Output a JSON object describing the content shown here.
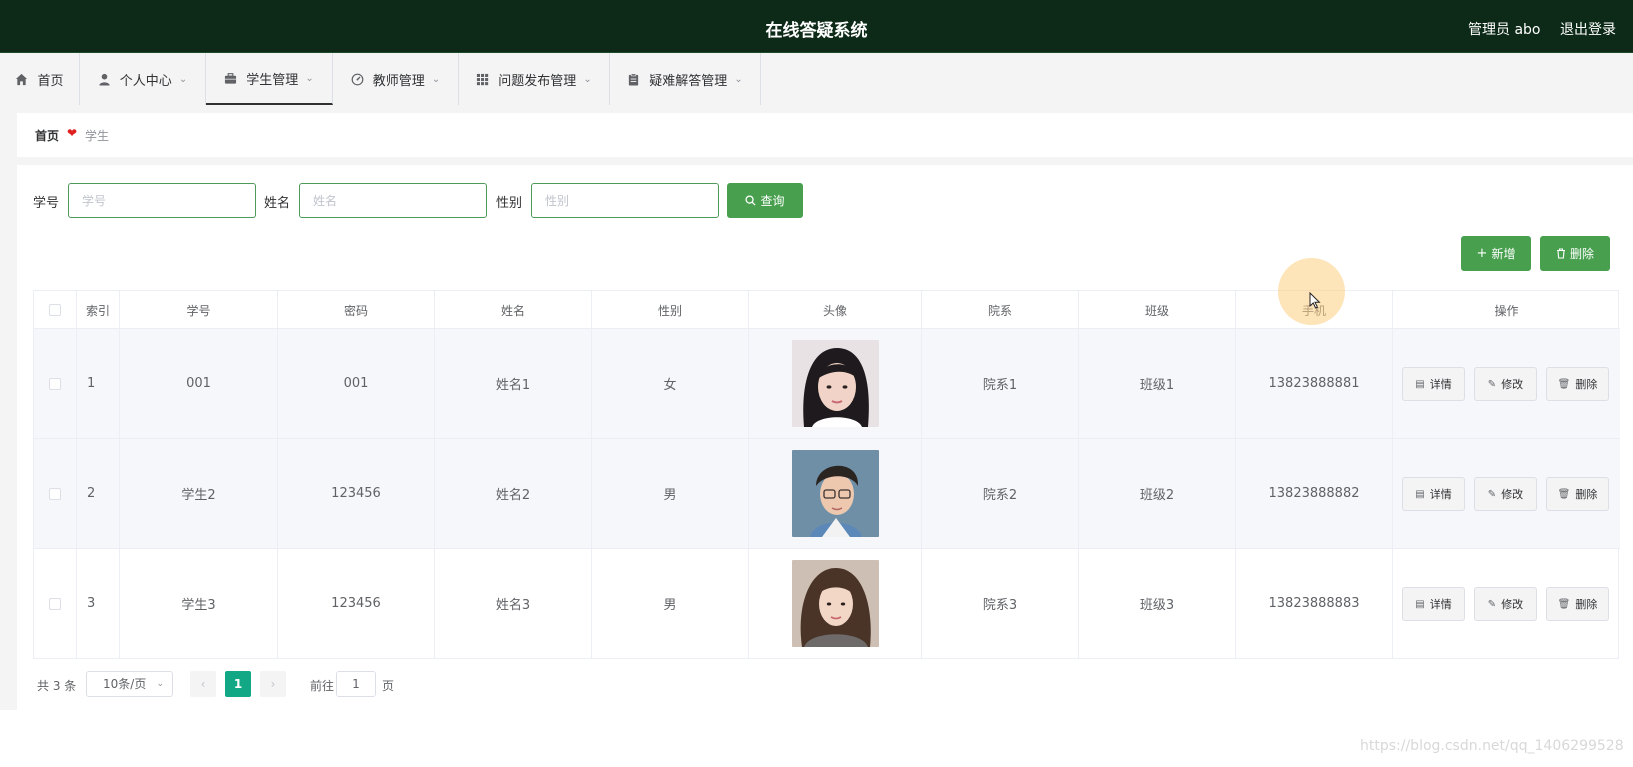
{
  "header": {
    "title": "在线答疑系统",
    "user": "管理员 abo",
    "logout": "退出登录"
  },
  "nav": {
    "items": [
      {
        "label": "首页",
        "icon": "home-icon"
      },
      {
        "label": "个人中心",
        "icon": "user-icon"
      },
      {
        "label": "学生管理",
        "icon": "briefcase-icon"
      },
      {
        "label": "教师管理",
        "icon": "gauge-icon"
      },
      {
        "label": "问题发布管理",
        "icon": "grid-icon"
      },
      {
        "label": "疑难解答管理",
        "icon": "clipboard-icon"
      }
    ],
    "active": "学生管理"
  },
  "breadcrumb": {
    "home": "首页",
    "current": "学生"
  },
  "search": {
    "fields": [
      {
        "label": "学号",
        "placeholder": "学号"
      },
      {
        "label": "姓名",
        "placeholder": "姓名"
      },
      {
        "label": "性别",
        "placeholder": "性别"
      }
    ],
    "query_button": "查询"
  },
  "actions": {
    "add": "新增",
    "delete": "删除"
  },
  "table": {
    "columns": [
      "索引",
      "学号",
      "密码",
      "姓名",
      "性别",
      "头像",
      "院系",
      "班级",
      "手机",
      "操作"
    ],
    "rows": [
      {
        "index": "1",
        "sid": "001",
        "password": "001",
        "name": "姓名1",
        "gender": "女",
        "dept": "院系1",
        "cls": "班级1",
        "phone": "13823888881"
      },
      {
        "index": "2",
        "sid": "学生2",
        "password": "123456",
        "name": "姓名2",
        "gender": "男",
        "dept": "院系2",
        "cls": "班级2",
        "phone": "13823888882"
      },
      {
        "index": "3",
        "sid": "学生3",
        "password": "123456",
        "name": "姓名3",
        "gender": "男",
        "dept": "院系3",
        "cls": "班级3",
        "phone": "13823888883"
      }
    ],
    "row_buttons": {
      "detail": "详情",
      "edit": "修改",
      "delete": "删除"
    }
  },
  "pagination": {
    "total": "共 3 条",
    "page_size": "10条/页",
    "current_page": "1",
    "goto_prefix": "前往",
    "goto_value": "1",
    "goto_suffix": "页"
  },
  "watermark": "https://blog.csdn.net/qq_1406299528",
  "colors": {
    "header_bg": "#0d2a18",
    "primary": "#48a04f",
    "pager_active": "#12a886"
  }
}
